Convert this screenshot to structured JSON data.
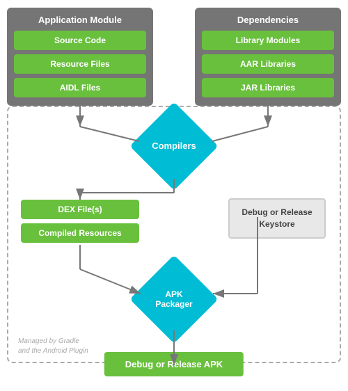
{
  "app_module": {
    "title": "Application Module",
    "items": [
      "Source Code",
      "Resource Files",
      "AIDL Files"
    ]
  },
  "dependencies": {
    "title": "Dependencies",
    "items": [
      "Library Modules",
      "AAR Libraries",
      "JAR Libraries"
    ]
  },
  "compilers": {
    "label": "Compilers"
  },
  "left_outputs": {
    "items": [
      "DEX File(s)",
      "Compiled Resources"
    ]
  },
  "keystore": {
    "label": "Debug or Release Keystore"
  },
  "apk_packager": {
    "label": "APK\nPackager"
  },
  "output": {
    "label": "Debug or Release APK"
  },
  "gradle_label": {
    "line1": "Managed by Gradle",
    "line2": "and the Android Plugin"
  }
}
